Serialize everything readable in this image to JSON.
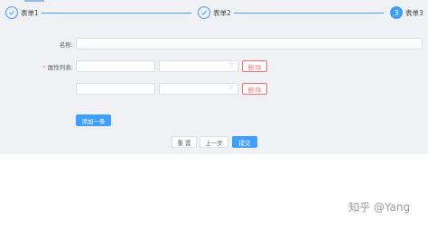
{
  "steps": [
    {
      "title": "表单1",
      "state": "done",
      "icon": "check-icon"
    },
    {
      "title": "表单2",
      "state": "done",
      "icon": "check-icon"
    },
    {
      "title": "表单3",
      "state": "active",
      "number": "3"
    }
  ],
  "form": {
    "name_label": "名称:",
    "name_value": "",
    "attr_label": "属性列表:",
    "required_mark": "*",
    "rows": [
      {
        "text_value": "",
        "select_value": "",
        "delete_label": "删 除"
      },
      {
        "text_value": "",
        "select_value": "",
        "delete_label": "删 除"
      }
    ],
    "add_label": "添加一条"
  },
  "footer": {
    "reset_label": "重 置",
    "prev_label": "上一步",
    "submit_label": "提交"
  },
  "watermark": "知乎 @Yang",
  "colors": {
    "primary": "#409eff",
    "danger": "#f56c6c"
  }
}
